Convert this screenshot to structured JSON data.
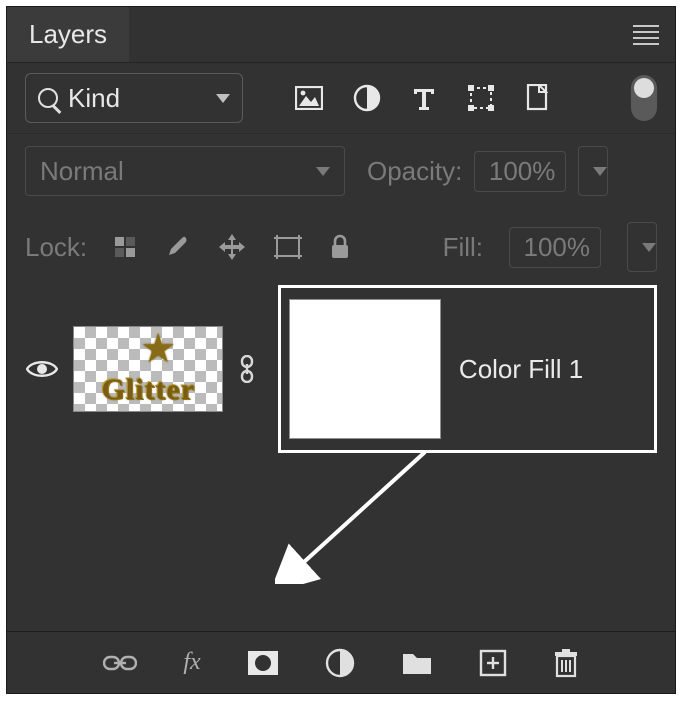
{
  "panel": {
    "title": "Layers"
  },
  "filter": {
    "label": "Kind"
  },
  "blend": {
    "mode": "Normal",
    "opacity_label": "Opacity:",
    "opacity_value": "100%"
  },
  "lock": {
    "label": "Lock:",
    "fill_label": "Fill:",
    "fill_value": "100%"
  },
  "layer": {
    "thumb_text": "Glitter",
    "name": "Color Fill 1"
  },
  "bottom": {
    "fx_label": "fx"
  }
}
